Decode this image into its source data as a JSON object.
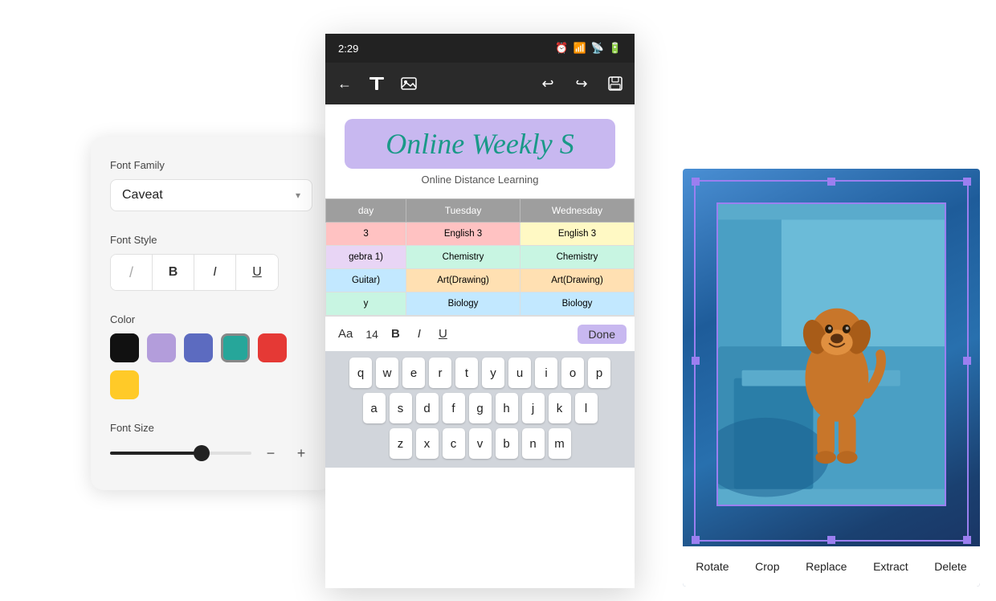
{
  "fontPanel": {
    "title": "Font Family",
    "fontFamilyLabel": "Font Family",
    "fontFamilyValue": "Caveat",
    "fontStyleLabel": "Font Style",
    "styleButtons": [
      {
        "id": "slash",
        "label": "/"
      },
      {
        "id": "bold",
        "label": "B"
      },
      {
        "id": "italic",
        "label": "I"
      },
      {
        "id": "underline",
        "label": "U"
      }
    ],
    "colorLabel": "Color",
    "colors": [
      {
        "name": "black",
        "hex": "#111111",
        "selected": false
      },
      {
        "name": "lavender",
        "hex": "#b39ddb",
        "selected": false
      },
      {
        "name": "blue",
        "hex": "#5c6bc0",
        "selected": false
      },
      {
        "name": "green",
        "hex": "#26a69a",
        "selected": true
      },
      {
        "name": "red",
        "hex": "#e53935",
        "selected": false
      },
      {
        "name": "yellow",
        "hex": "#ffca28",
        "selected": false
      }
    ],
    "fontSizeLabel": "Font Size",
    "sliderMin": 8,
    "sliderMax": 72,
    "sliderValue": 45,
    "minusLabel": "−",
    "plusLabel": "+"
  },
  "phoneApp": {
    "statusBarTime": "2:29",
    "docTitle": "Online Weekly S",
    "docSubtitle": "Online Distance Learning",
    "tableHeaders": [
      "day",
      "Tuesday",
      "Wednesday"
    ],
    "tableRows": [
      [
        "3",
        "English 3",
        "English 3"
      ],
      [
        "gebra 1)",
        "Chemistry",
        "Chemistry"
      ],
      [
        "Guitar)",
        "Art(Drawing)",
        "Art(Drawing)"
      ],
      [
        "y",
        "Biology",
        "Biology"
      ]
    ],
    "formatBar": {
      "aaLabel": "Aa",
      "sizeValue": "14",
      "boldLabel": "B",
      "italicLabel": "I",
      "underlineLabel": "U",
      "doneLabel": "Done"
    },
    "keyboard": {
      "row1": [
        "q",
        "w",
        "e",
        "r",
        "t",
        "y",
        "u",
        "i",
        "o",
        "p"
      ],
      "row2": [
        "a",
        "s",
        "d",
        "f",
        "g",
        "h",
        "j",
        "k",
        "l"
      ],
      "row3": [
        "z",
        "x",
        "c",
        "v",
        "b",
        "n",
        "m"
      ]
    }
  },
  "imagePanel": {
    "toolbarButtons": [
      "Rotate",
      "Crop",
      "Replace",
      "Extract",
      "Delete"
    ]
  }
}
